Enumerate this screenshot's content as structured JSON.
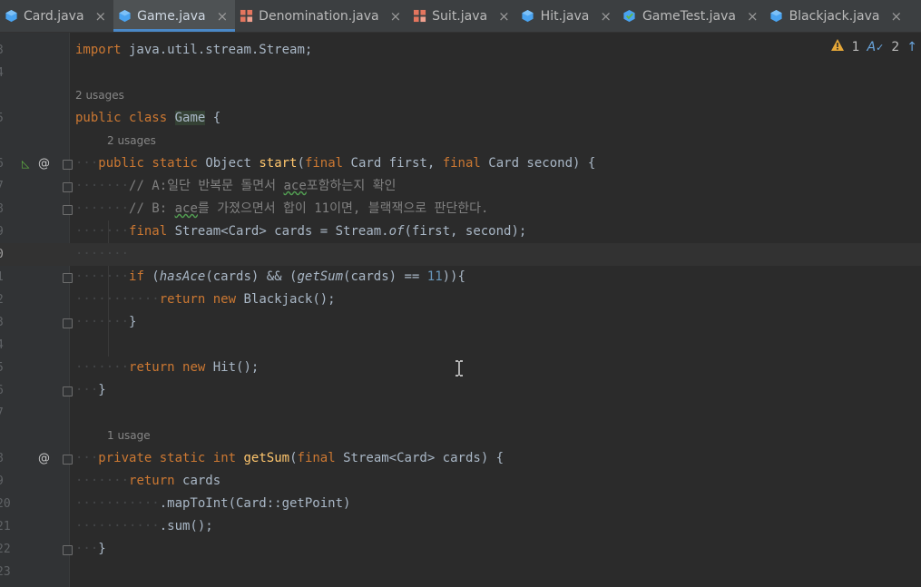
{
  "tabs": [
    {
      "label": "Card.java",
      "icon": "class-icon",
      "active": false
    },
    {
      "label": "Game.java",
      "icon": "class-icon",
      "active": true
    },
    {
      "label": "Denomination.java",
      "icon": "enum-icon",
      "active": false
    },
    {
      "label": "Suit.java",
      "icon": "enum-icon",
      "active": false
    },
    {
      "label": "Hit.java",
      "icon": "class-icon",
      "active": false
    },
    {
      "label": "GameTest.java",
      "icon": "test-class-icon",
      "active": false
    },
    {
      "label": "Blackjack.java",
      "icon": "class-icon",
      "active": false
    }
  ],
  "close_glyph": "×",
  "more_tabs_glyph": "↓",
  "inspection": {
    "warnings": "1",
    "typos": "2"
  },
  "usages": {
    "class": "2 usages",
    "start": "2 usages",
    "getSum": "1 usage"
  },
  "line_numbers": [
    "3",
    "4",
    "5",
    "6",
    "7",
    "8",
    "9",
    "0",
    "1",
    "2",
    "3",
    "4",
    "5",
    "6",
    "7",
    "8",
    "9",
    "20",
    "21",
    "22",
    "23"
  ],
  "code": {
    "l3": {
      "kw": "import",
      "rest": " java.util.stream.Stream;"
    },
    "l5": {
      "kw1": "public",
      "kw2": "class",
      "name": "Game",
      "rest": " {"
    },
    "l6": {
      "kw1": "public",
      "kw2": "static",
      "type": "Object",
      "fn": "start",
      "p1": "(",
      "kw3": "final",
      "t1": "Card",
      "a1": " first, ",
      "kw4": "final",
      "t2": "Card",
      "a2": " second) {"
    },
    "l7": {
      "text1": "// A:일단 반복문 돌면서 ",
      "wavy": "ace",
      "text2": "포함하는지 확인"
    },
    "l8": {
      "text1": "// B: ",
      "wavy": "ace",
      "text2": "를 가졌으면서 합이 11이면, 블랙잭으로 판단한다."
    },
    "l9": {
      "kw": "final",
      "rest1": " Stream<Card> cards = Stream.",
      "it": "of",
      "rest2": "(first, second);"
    },
    "l11": {
      "kw": "if",
      "rest1": " (",
      "it1": "hasAce",
      "rest2": "(cards) && (",
      "it2": "getSum",
      "rest3": "(cards) == ",
      "num": "11",
      "rest4": ")){"
    },
    "l12": {
      "kw1": "return",
      "kw2": "new",
      "rest": " Blackjack();"
    },
    "l13": {
      "rest": "}"
    },
    "l15": {
      "kw1": "return",
      "kw2": "new",
      "rest": " Hit();"
    },
    "l16": {
      "rest": "}"
    },
    "l18": {
      "kw1": "private",
      "kw2": "static",
      "kw3": "int",
      "fn": "getSum",
      "p1": "(",
      "kw4": "final",
      "rest": " Stream<Card> cards) {"
    },
    "l19": {
      "kw": "return",
      "rest": " cards"
    },
    "l20": {
      "rest": ".mapToInt(Card::getPoint)"
    },
    "l21": {
      "rest": ".sum();"
    },
    "l22": {
      "rest": "}"
    }
  }
}
